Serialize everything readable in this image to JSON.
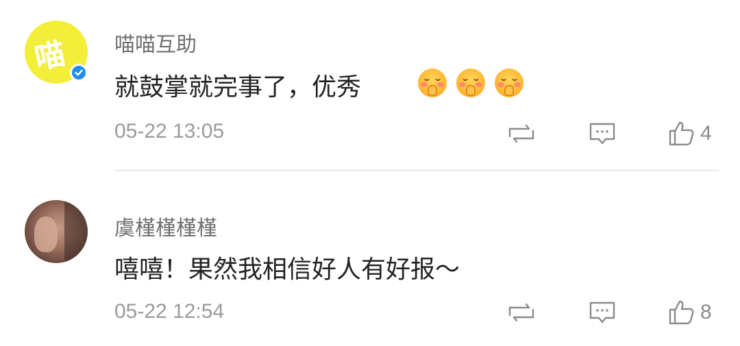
{
  "comments": [
    {
      "avatar_char": "喵",
      "verified": true,
      "username": "喵喵互助",
      "text": "就鼓掌就完事了，优秀",
      "emoji": [
        "face-with-hands-emoji",
        "face-with-hands-emoji",
        "face-with-hands-emoji"
      ],
      "time": "05-22 13:05",
      "likes": "4"
    },
    {
      "verified": false,
      "username": "虞槿槿槿槿",
      "text": "嘻嘻！果然我相信好人有好报～",
      "time": "05-22 12:54",
      "likes": "8"
    }
  ],
  "colors": {
    "avatar_yellow": "#f3ee3a",
    "verified_blue": "#1f8ef1",
    "icon_gray": "#8a8a8a"
  }
}
